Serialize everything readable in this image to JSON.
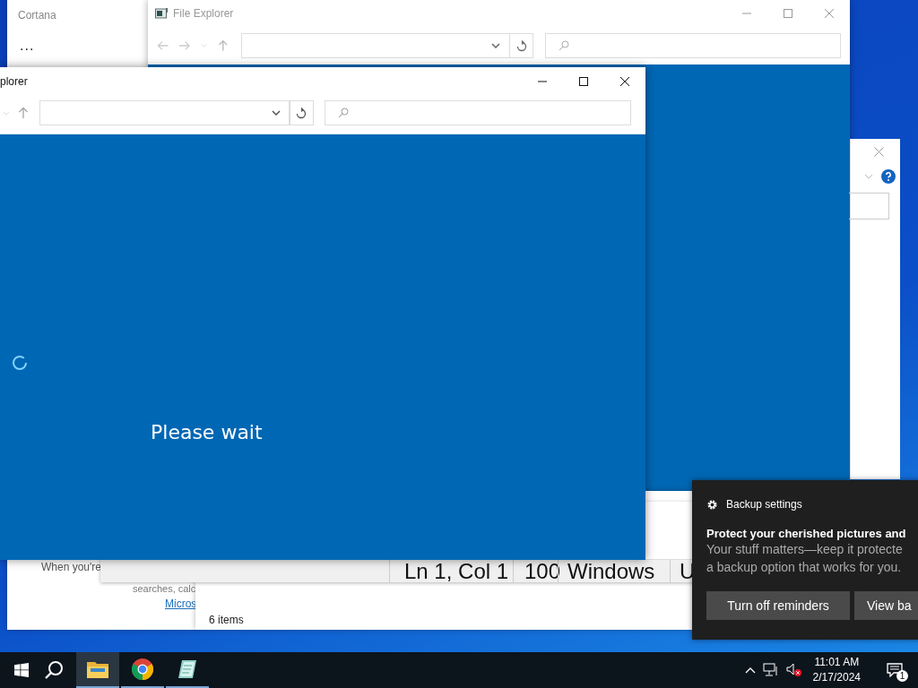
{
  "cortana": {
    "title": "Cortana",
    "more": "...",
    "hint": "When you're",
    "hint_2": "searches, calc",
    "link": "Micros"
  },
  "back_explorer": {
    "title": "File Explorer"
  },
  "front_explorer": {
    "title": "plorer",
    "message": "Please wait"
  },
  "notepad_status": [
    "Ln 1, Col 1",
    "100",
    "Windows",
    "U"
  ],
  "explorer_status": "6 items",
  "notification": {
    "app": "Backup settings",
    "title": "Protect your cherished pictures and",
    "body": [
      "Your stuff matters—keep it protecte",
      "a backup option that works for you."
    ],
    "buttons": [
      "Turn off reminders",
      "View ba"
    ]
  },
  "taskbar": {
    "apps": [
      {
        "kind": "explorer",
        "selected": true
      },
      {
        "kind": "chrome",
        "selected": false
      },
      {
        "kind": "notepad",
        "selected": false
      }
    ],
    "time": "11:01 AM",
    "date": "2/17/2024",
    "notification_count": "1"
  }
}
